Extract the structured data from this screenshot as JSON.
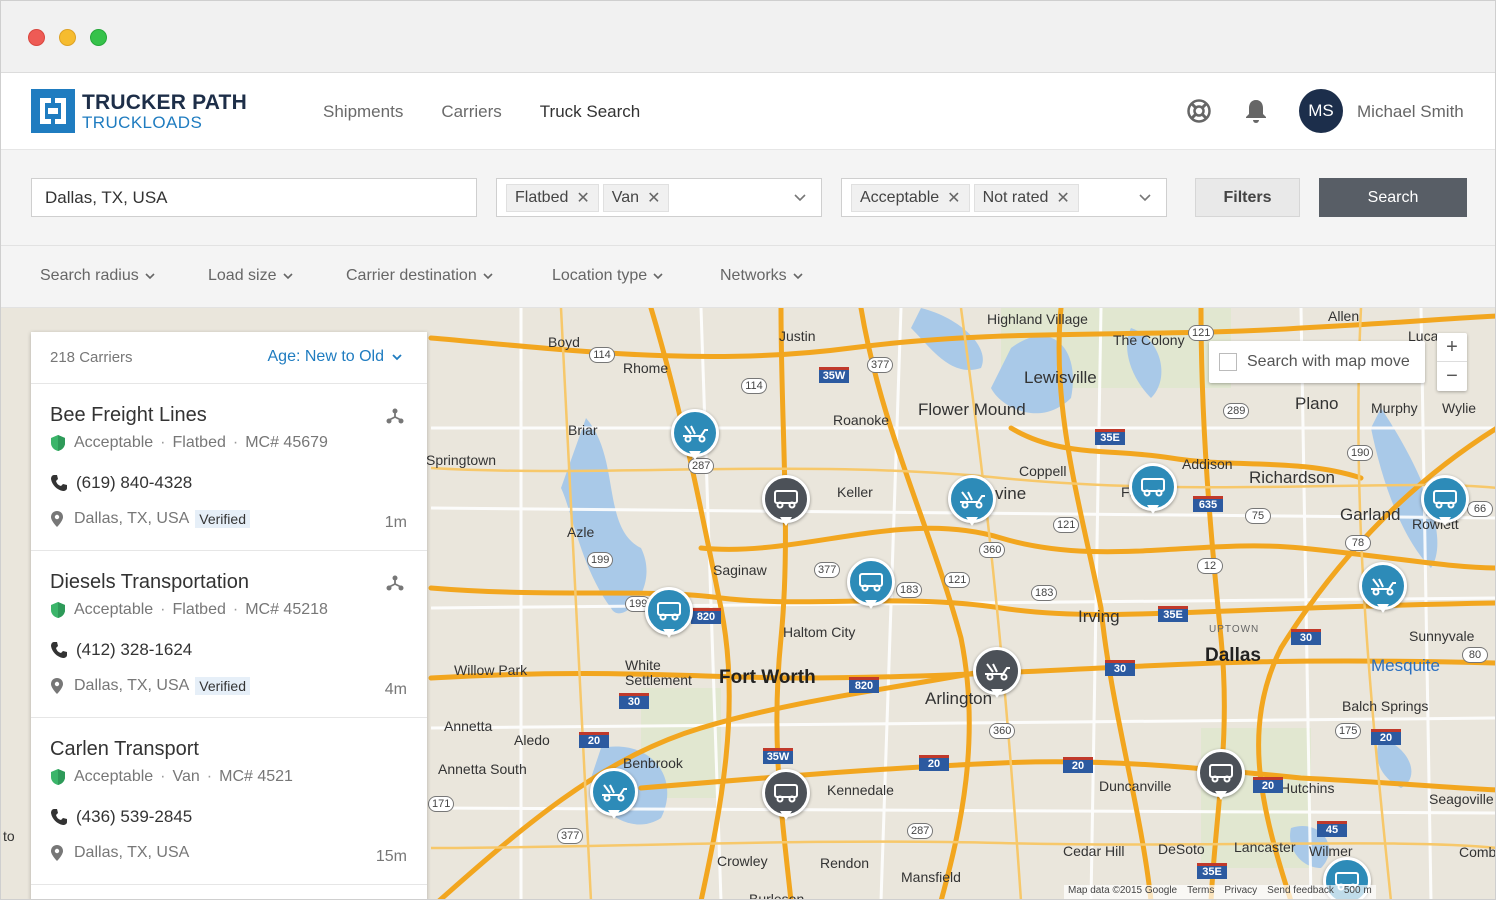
{
  "window": {
    "controls": [
      "close",
      "minimize",
      "maximize"
    ]
  },
  "header": {
    "logo_line1": "TRUCKER PATH",
    "logo_line2": "TRUCKLOADS",
    "nav": [
      {
        "label": "Shipments",
        "active": false
      },
      {
        "label": "Carriers",
        "active": false
      },
      {
        "label": "Truck Search",
        "active": true
      }
    ],
    "icons": [
      "lifebuoy-icon",
      "bell-icon"
    ],
    "user": {
      "initials": "MS",
      "name": "Michael Smith"
    }
  },
  "search": {
    "location": "Dallas, TX, USA",
    "equipment_chips": [
      "Flatbed",
      "Van"
    ],
    "rating_chips": [
      "Acceptable",
      "Not rated"
    ],
    "filters_label": "Filters",
    "search_label": "Search"
  },
  "filters": [
    "Search radius",
    "Load size",
    "Carrier destination",
    "Location type",
    "Networks"
  ],
  "carriers_panel": {
    "count": "218 Carriers",
    "sort": "Age: New to Old",
    "items": [
      {
        "name": "Bee Freight Lines",
        "rating": "Acceptable",
        "equipment": "Flatbed",
        "mc": "MC# 45679",
        "phone": "(619) 840-4328",
        "location": "Dallas, TX, USA",
        "verified": "Verified",
        "age": "1m"
      },
      {
        "name": "Diesels Transportation",
        "rating": "Acceptable",
        "equipment": "Flatbed",
        "mc": "MC# 45218",
        "phone": "(412) 328-1624",
        "location": "Dallas, TX, USA",
        "verified": "Verified",
        "age": "4m"
      },
      {
        "name": "Carlen Transport",
        "rating": "Acceptable",
        "equipment": "Van",
        "mc": "MC# 4521",
        "phone": "(436) 539-2845",
        "location": "Dallas, TX, USA",
        "verified": "",
        "age": "15m"
      }
    ]
  },
  "map": {
    "search_with_map_move": "Search with map move",
    "zoom_in": "+",
    "zoom_out": "−",
    "attribution": [
      "Map data ©2015 Google",
      "Terms",
      "Privacy",
      "Send feedback",
      "500 m"
    ],
    "cities": {
      "highland_village": "Highland Village",
      "allen": "Allen",
      "lucas": "Luca",
      "the_colony": "The Colony",
      "justin": "Justin",
      "boyd": "Boyd",
      "rhome": "Rhome",
      "lewisville": "Lewisville",
      "flower_mound": "Flower Mound",
      "plano": "Plano",
      "murphy": "Murphy",
      "wylie": "Wylie",
      "roanoke": "Roanoke",
      "briar": "Briar",
      "springtown": "Springtown",
      "keller": "Keller",
      "coppell": "Coppell",
      "irving_partial": "vine",
      "addison": "Addison",
      "richardson": "Richardson",
      "farmers_branch": "Fa Bra   n",
      "garland": "Garland",
      "rowlett": "Rowlett",
      "azle": "Azle",
      "saginaw": "Saginaw",
      "irving": "Irving",
      "haltom_city": "Haltom City",
      "uptown": "UPTOWN",
      "dallas": "Dallas",
      "sunnyvale": "Sunnyvale",
      "willow_park": "Willow Park",
      "white_settlement": "White Settlement",
      "fort_worth": "Fort Worth",
      "arlington": "Arlington",
      "mesquite": "Mesquite",
      "balch_springs": "Balch Springs",
      "annetta": "Annetta",
      "aledo": "Aledo",
      "annetta_south": "Annetta South",
      "benbrook": "Benbrook",
      "kennedale": "Kennedale",
      "duncanville": "Duncanville",
      "hutchins": "Hutchins",
      "seagoville": "Seagoville",
      "cedar_hill": "Cedar Hill",
      "desoto": "DeSoto",
      "lancaster": "Lancaster",
      "wilmer": "Wilmer",
      "combine": "Comb",
      "crowley": "Crowley",
      "rendon": "Rendon",
      "mansfield": "Mansfield",
      "burleson": "Burleson",
      "left_edge": "to"
    },
    "routes": [
      "114",
      "377",
      "35W",
      "121",
      "289",
      "35E",
      "287",
      "114",
      "190",
      "635",
      "75",
      "66",
      "121",
      "360",
      "78",
      "199",
      "377",
      "121",
      "183",
      "12",
      "183",
      "820",
      "199",
      "35E",
      "30",
      "80",
      "30",
      "820",
      "30",
      "20",
      "360",
      "175",
      "20",
      "35W",
      "20",
      "20",
      "20",
      "171",
      "377",
      "287",
      "45",
      "35E"
    ]
  },
  "colors": {
    "brand": "#1f7cc0",
    "pin_blue": "#2d8bb8",
    "pin_gray": "#4c5158",
    "rating_green": "#3bb56a"
  }
}
